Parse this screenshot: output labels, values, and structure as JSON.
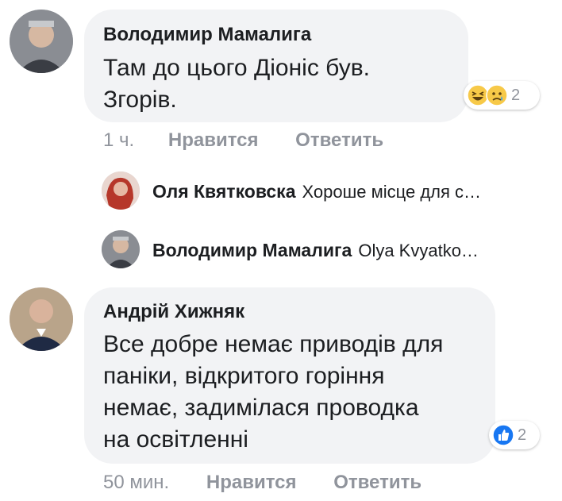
{
  "comments": [
    {
      "author": "Володимир Мамалига",
      "text": "Там до цього Діоніс був.\nЗгорів.",
      "reactions": {
        "icons": [
          "haha-icon",
          "sad-icon"
        ],
        "count": "2"
      },
      "timestamp": "1 ч.",
      "like_label": "Нравится",
      "reply_label": "Ответить",
      "replies": [
        {
          "author": "Оля Квятковска",
          "text": "Хороше місце для с…"
        },
        {
          "author": "Володимир Мамалига",
          "text": "Olya  Kvyatko…"
        }
      ]
    },
    {
      "author": "Андрій Хижняк",
      "text": "Все добре немає приводів для\nпаніки, відкритого горіння\nнемає, задимілася проводка\nна освітленні",
      "reactions": {
        "icons": [
          "like-icon"
        ],
        "count": "2"
      },
      "timestamp": "50 мин.",
      "like_label": "Нравится",
      "reply_label": "Ответить"
    }
  ],
  "colors": {
    "bubble": "#f2f3f5",
    "meta": "#90949c",
    "like_blue": "#1877f2",
    "emoji_yellow": "#f7c948"
  }
}
